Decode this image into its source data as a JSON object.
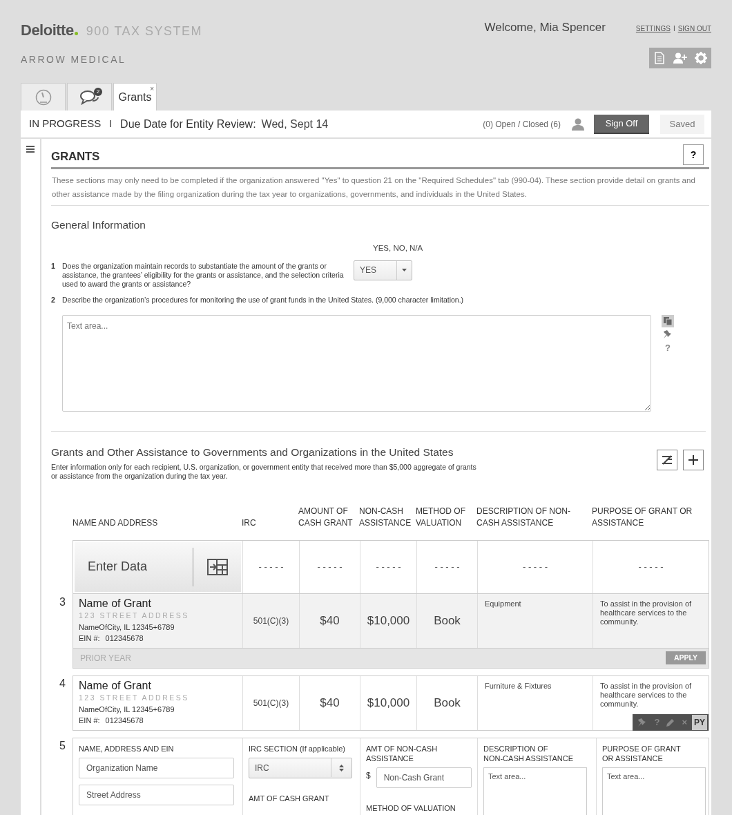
{
  "header": {
    "logo": "Deloitte",
    "product": "900 TAX SYSTEM",
    "client": "ARROW MEDICAL",
    "welcome": "Welcome, Mia Spencer",
    "links": [
      "SETTINGS",
      "SIGN OUT"
    ],
    "link_separator": "I"
  },
  "tabs": [
    {
      "kind": "dashboard",
      "selected": false
    },
    {
      "kind": "messages",
      "badge": "2",
      "selected": false
    },
    {
      "kind": "text",
      "label": "Grants",
      "close": "×",
      "selected": true
    }
  ],
  "status_bar": {
    "state": "IN PROGRESS",
    "separator": "I",
    "due_label": "Due Date for Entity Review:",
    "due_date": "Wed, Sept 14",
    "counts": "(0) Open / Closed (6)",
    "sign_off": "Sign Off",
    "saved": "Saved"
  },
  "section": {
    "title": "GRANTS",
    "help": "?",
    "intro": "These sections may only need to be completed if the organization answered \"Yes\" to question 21 on the \"Required Schedules\" tab (990-04).  These section provide detail on grants and other assistance made by the filing organization during the tax year to organizations, governments, and individuals in the United States."
  },
  "general": {
    "title": "General Information",
    "answer_header": "YES, NO, N/A",
    "questions": [
      {
        "number": "1",
        "kind": "select",
        "text": "Does the organization maintain records to substantiate the amount of the grants or assistance, the grantees’ eligibility for the grants or assistance, and the selection criteria used to award the grants or assistance?",
        "value": "YES"
      },
      {
        "number": "2",
        "kind": "textarea",
        "text": "Describe the organization’s procedures for monitoring the use of grant funds in the United States. (9,000 character limitation.)",
        "placeholder": "Text area...",
        "help": "?"
      }
    ]
  },
  "grants": {
    "title": "Grants and Other Assistance to Governments and Organizations in the United States",
    "description": "Enter information only for each recipient, U.S. organization, or government entity that received more than $5,000 aggregate of grants or assistance from the organization during the tax year.",
    "columns": [
      "NAME AND ADDRESS",
      "IRC",
      "AMOUNT OF CASH GRANT",
      "NON-CASH ASSISTANCE",
      "METHOD OF VALUATION",
      "DESCRIPTION OF NON-CASH ASSISTANCE",
      "PURPOSE OF GRANT OR ASSISTANCE"
    ],
    "enter_row": {
      "label": "Enter Data",
      "cells": [
        "- - - - -",
        "- - - - -",
        "- - - - -",
        "- - - - -",
        "- - - - -",
        "- - - - -"
      ]
    },
    "rows": [
      {
        "number": "3",
        "name": "Name of Grant",
        "street": "123 STREET ADDRESS",
        "city": "NameOfCity, IL 12345+6789",
        "ein_label": "EIN #:",
        "ein": "012345678",
        "irc": "501(C)(3)",
        "cash": "$40",
        "noncash": "$10,000",
        "method": "Book",
        "description": "Equipment",
        "purpose": "To assist in the provision of healthcare services to the community.",
        "prior_year": {
          "label": "PRIOR YEAR",
          "button": "APPLY"
        }
      },
      {
        "number": "4",
        "name": "Name of Grant",
        "street": "123 STREET ADDRESS",
        "city": "NameOfCity, IL 12345+6789",
        "ein_label": "EIN #:",
        "ein": "012345678",
        "irc": "501(C)(3)",
        "cash": "$40",
        "noncash": "$10,000",
        "method": "Book",
        "description": "Furniture & Fixtures",
        "purpose": "To assist in the provision of healthcare services to the community.",
        "toolbar": {
          "help": "?",
          "close": "×",
          "py": "PY"
        }
      }
    ],
    "form_row": {
      "number": "5",
      "name_label": "NAME, ADDRESS AND EIN",
      "name_placeholders": [
        "Organization Name",
        "Street Address"
      ],
      "irc_label": "IRC SECTION (If applicable)",
      "irc_value": "IRC",
      "cash_label": "AMT OF CASH GRANT",
      "noncash_label": "AMT OF NON-CASH ASSISTANCE",
      "currency": "$",
      "noncash_placeholder": "Non-Cash Grant",
      "method_label": "METHOD OF VALUATION",
      "description_label": "DESCRIPTION OF\nNON-CASH ASSISTANCE",
      "description_placeholder": "Text area...",
      "purpose_label": "PURPOSE OF GRANT\nOR ASSISTANCE",
      "purpose_placeholder": "Text area..."
    }
  }
}
